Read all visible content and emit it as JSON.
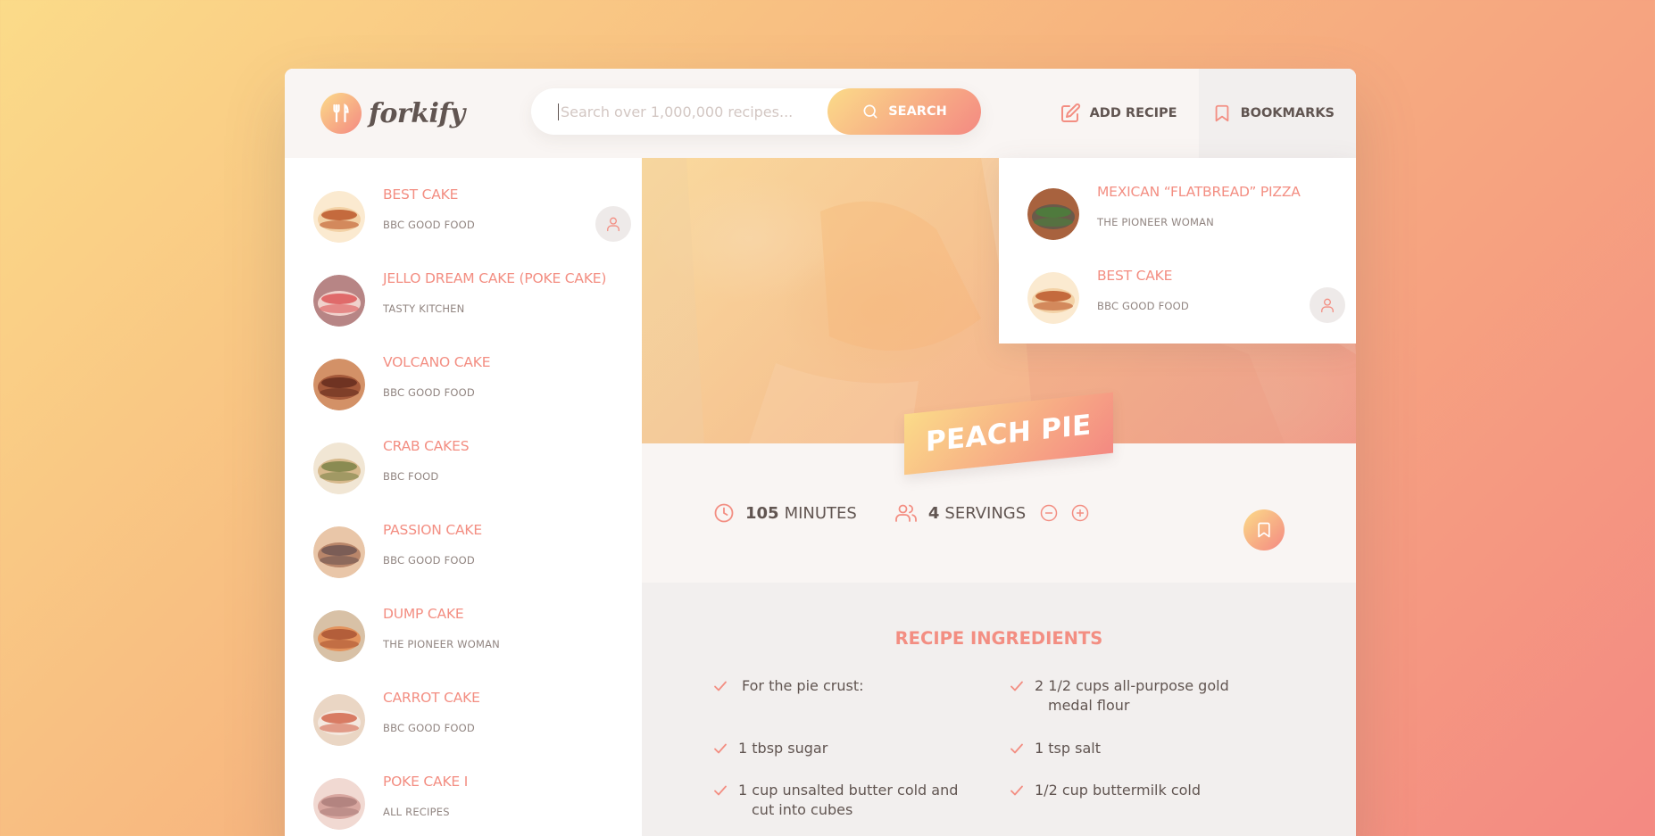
{
  "header": {
    "logo_text": "forkify",
    "search_placeholder": "Search over 1,000,000 recipes...",
    "search_button": "SEARCH",
    "add_recipe": "ADD RECIPE",
    "bookmarks": "BOOKMARKS"
  },
  "results": [
    {
      "title": "BEST CAKE",
      "publisher": "BBC GOOD FOOD",
      "user_generated": true,
      "colors": [
        "#f3d2a6",
        "#c46a3d",
        "#fbead0"
      ]
    },
    {
      "title": "JELLO DREAM CAKE (POKE CAKE)",
      "publisher": "TASTY KITCHEN",
      "user_generated": false,
      "colors": [
        "#f0d2cc",
        "#e06a6a",
        "#b78585"
      ]
    },
    {
      "title": "VOLCANO CAKE",
      "publisher": "BBC GOOD FOOD",
      "user_generated": false,
      "colors": [
        "#a55a3b",
        "#6f3322",
        "#d39167"
      ]
    },
    {
      "title": "CRAB CAKES",
      "publisher": "BBC FOOD",
      "user_generated": false,
      "colors": [
        "#d7b98c",
        "#8a8b52",
        "#f1e6d4"
      ]
    },
    {
      "title": "PASSION CAKE",
      "publisher": "BBC GOOD FOOD",
      "user_generated": false,
      "colors": [
        "#b9866a",
        "#7b5d56",
        "#e9c6a8"
      ]
    },
    {
      "title": "DUMP CAKE",
      "publisher": "THE PIONEER WOMAN",
      "user_generated": false,
      "colors": [
        "#e3935d",
        "#b35e3a",
        "#d8c1a6"
      ]
    },
    {
      "title": "CARROT CAKE",
      "publisher": "BBC GOOD FOOD",
      "user_generated": false,
      "colors": [
        "#f4e8df",
        "#d87b63",
        "#ead6c4"
      ]
    },
    {
      "title": "POKE CAKE I",
      "publisher": "ALL RECIPES",
      "user_generated": false,
      "colors": [
        "#d8a7a0",
        "#b38480",
        "#f1d9d2"
      ]
    }
  ],
  "recipe": {
    "title": "PEACH PIE",
    "cooking_time": "105",
    "cooking_time_unit": "MINUTES",
    "servings": "4",
    "servings_unit": "SERVINGS",
    "ingredients_heading": "RECIPE INGREDIENTS",
    "ingredients": [
      "For the pie crust:",
      "2 1/2 cups all-purpose gold medal flour",
      "1 tbsp sugar",
      "1 tsp salt",
      "1 cup unsalted butter cold and cut into cubes",
      "1/2 cup buttermilk cold"
    ]
  },
  "bookmarks": [
    {
      "title": "MEXICAN “FLATBREAD” PIZZA",
      "publisher": "THE PIONEER WOMAN",
      "user_generated": false,
      "colors": [
        "#6a5a4a",
        "#4f7a3d",
        "#a8623e"
      ]
    },
    {
      "title": "BEST CAKE",
      "publisher": "BBC GOOD FOOD",
      "user_generated": true,
      "colors": [
        "#f3d2a6",
        "#c46a3d",
        "#fbead0"
      ]
    }
  ],
  "colors": {
    "accent": "#f38e82",
    "gradient_start": "#fbdb89",
    "gradient_end": "#f48982",
    "text": "#615551"
  },
  "icons": {
    "logo": "fork-knife-icon",
    "search": "search-icon",
    "add_recipe": "edit-icon",
    "bookmarks": "bookmark-icon",
    "user": "user-icon",
    "time": "clock-icon",
    "servings": "users-icon",
    "decrease": "minus-circle-icon",
    "increase": "plus-circle-icon",
    "check": "check-icon"
  }
}
